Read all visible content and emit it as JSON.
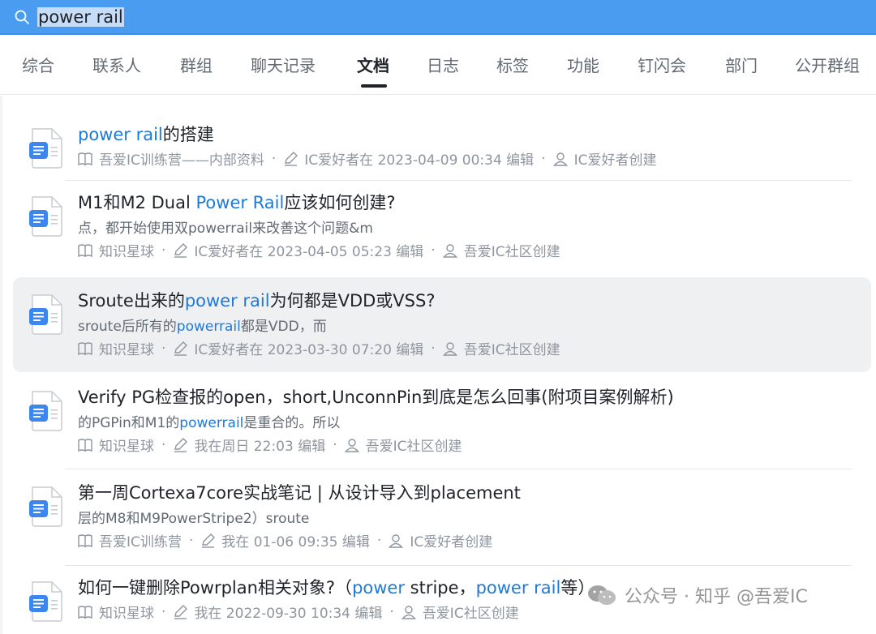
{
  "search": {
    "query": "power rail"
  },
  "tabs": [
    {
      "label": "综合"
    },
    {
      "label": "联系人"
    },
    {
      "label": "群组"
    },
    {
      "label": "聊天记录"
    },
    {
      "label": "文档"
    },
    {
      "label": "日志"
    },
    {
      "label": "标签"
    },
    {
      "label": "功能"
    },
    {
      "label": "钉闪会"
    },
    {
      "label": "部门"
    },
    {
      "label": "公开群组"
    }
  ],
  "active_tab": "文档",
  "results": [
    {
      "title": [
        "",
        "power rail",
        "的搭建"
      ],
      "snippet": null,
      "source": "吾爱IC训练营——内部资料",
      "edited": "IC爱好者在 2023-04-09 00:34 编辑",
      "creator": "IC爱好者创建"
    },
    {
      "title": [
        "M1和M2 Dual ",
        "Power Rail",
        "应该如何创建?"
      ],
      "snippet": [
        "点，都开始使用双powerrail来改善这个问题&m",
        "",
        ""
      ],
      "source": "知识星球",
      "edited": "IC爱好者在 2023-04-05 05:23 编辑",
      "creator": "吾爱IC社区创建"
    },
    {
      "title": [
        "Sroute出来的",
        "power rail",
        "为何都是VDD或VSS?"
      ],
      "snippet": [
        "sroute后所有的",
        "powerrail",
        "都是VDD，而"
      ],
      "source": "知识星球",
      "edited": "IC爱好者在 2023-03-30 07:20 编辑",
      "creator": "吾爱IC社区创建"
    },
    {
      "title": [
        "Verify PG检查报的open，short,UnconnPin到底是怎么回事(附项目案例解析)",
        "",
        ""
      ],
      "snippet": [
        "的PGPin和M1的",
        "powerrail",
        "是重合的。所以"
      ],
      "source": "知识星球",
      "edited": "我在周日 22:03 编辑",
      "creator": "吾爱IC社区创建"
    },
    {
      "title": [
        "第一周Cortexa7core实战笔记 | 从设计导入到placement",
        "",
        ""
      ],
      "snippet": [
        "层的M8和M9PowerStripe2）sroute",
        "",
        ""
      ],
      "source": "吾爱IC训练营",
      "edited": "我在 01-06 09:35 编辑",
      "creator": "IC爱好者创建"
    },
    {
      "title": [
        "如何一键删除Powrplan相关对象?（",
        "power",
        " stripe，",
        "power rail",
        "等）"
      ],
      "snippet": null,
      "source": "知识星球",
      "edited": "我在 2022-09-30 10:34 编辑",
      "creator": "吾爱IC社区创建"
    }
  ],
  "watermark": {
    "text": "公众号 · 知乎 @吾爱IC",
    "icon": "wechat-icon"
  },
  "colors": {
    "accent": "#4a9cf0",
    "highlight": "#1e7ad9",
    "hover_row": "#eff0f1"
  }
}
